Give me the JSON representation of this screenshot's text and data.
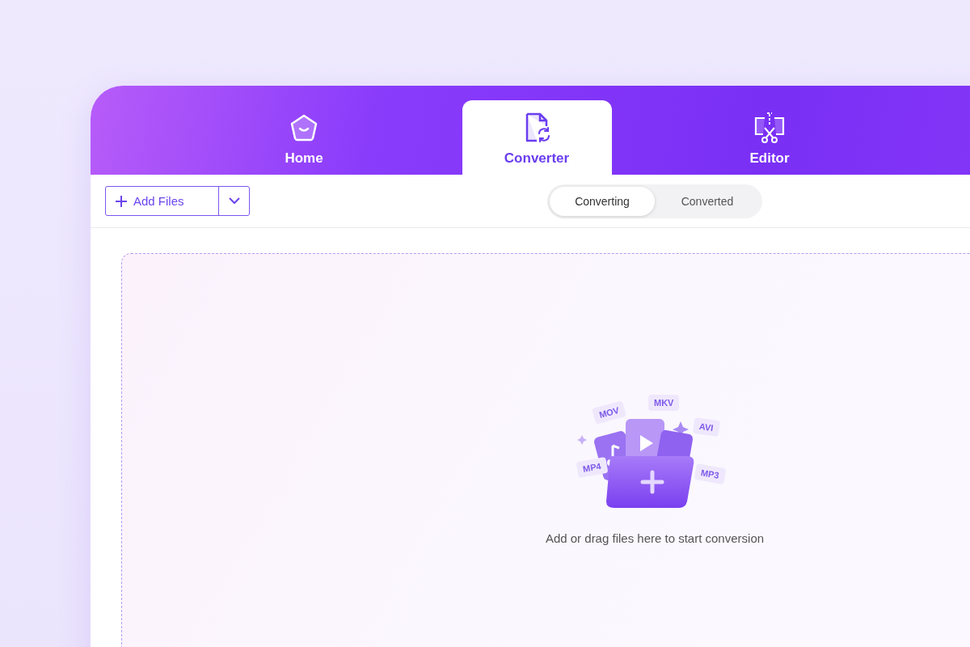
{
  "tabs": [
    {
      "label": "Home",
      "kind": "home",
      "selected": false
    },
    {
      "label": "Converter",
      "kind": "converter",
      "selected": true
    },
    {
      "label": "Editor",
      "kind": "editor",
      "selected": false
    }
  ],
  "add_button": {
    "label": "Add Files"
  },
  "segments": [
    {
      "label": "Converting",
      "selected": true
    },
    {
      "label": "Converted",
      "selected": false
    }
  ],
  "dropzone": {
    "format_tags": [
      "MOV",
      "MKV",
      "AVI",
      "MP4",
      "MP3"
    ],
    "hint": "Add or drag files here to start conversion"
  }
}
